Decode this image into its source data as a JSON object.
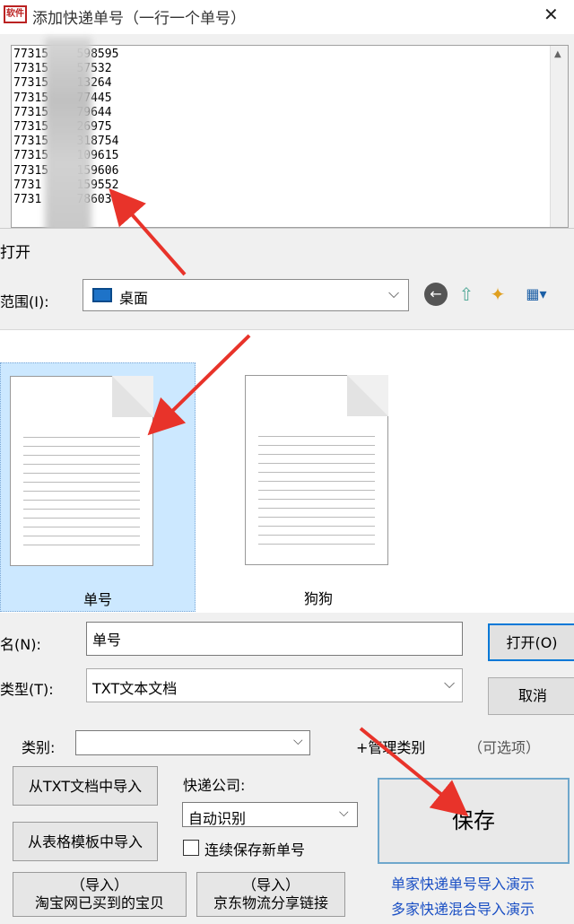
{
  "window": {
    "title": "添加快递单号（一行一个单号）",
    "logo_text": "软件"
  },
  "tracking": {
    "lines": [
      "77315    598595",
      "77315    57532",
      "77315    13264",
      "77315    77445",
      "77315    79644",
      "77315    26975",
      "77315    318754",
      "77315    109615",
      "77315    159606",
      "7731     159552",
      "7731     78603"
    ]
  },
  "open_dialog": {
    "title": "打开",
    "lookin_label": "范围(I):",
    "lookin_value": "桌面",
    "files": [
      {
        "label": "单号",
        "selected": true
      },
      {
        "label": "狗狗",
        "selected": false
      }
    ],
    "filename_label": "名(N):",
    "filename_value": "单号",
    "filetype_label": "类型(T):",
    "filetype_value": "TXT文本文档",
    "open_label": "打开(O)",
    "cancel_label": "取消"
  },
  "panel": {
    "category_label": "类别:",
    "category_value": "",
    "manage_category": "+管理类别",
    "optional_hint": "（可选项）",
    "import_txt": "从TXT文档中导入",
    "import_template": "从表格模板中导入",
    "courier_label": "快递公司:",
    "courier_value": "自动识别",
    "continue_label": "连续保存新单号",
    "continue_checked": false,
    "save_label": "保存",
    "import_taobao_line1": "（导入）",
    "import_taobao_line2": "淘宝网已买到的宝贝",
    "import_jd_line1": "（导入）",
    "import_jd_line2": "京东物流分享链接",
    "demo_single": "单家快递单号导入演示",
    "demo_mixed": "多家快递混合导入演示"
  },
  "colors": {
    "accent": "#0078d7",
    "link": "#1a4fc4",
    "selection": "#cce8ff",
    "annotation_arrow": "#e8332a"
  }
}
